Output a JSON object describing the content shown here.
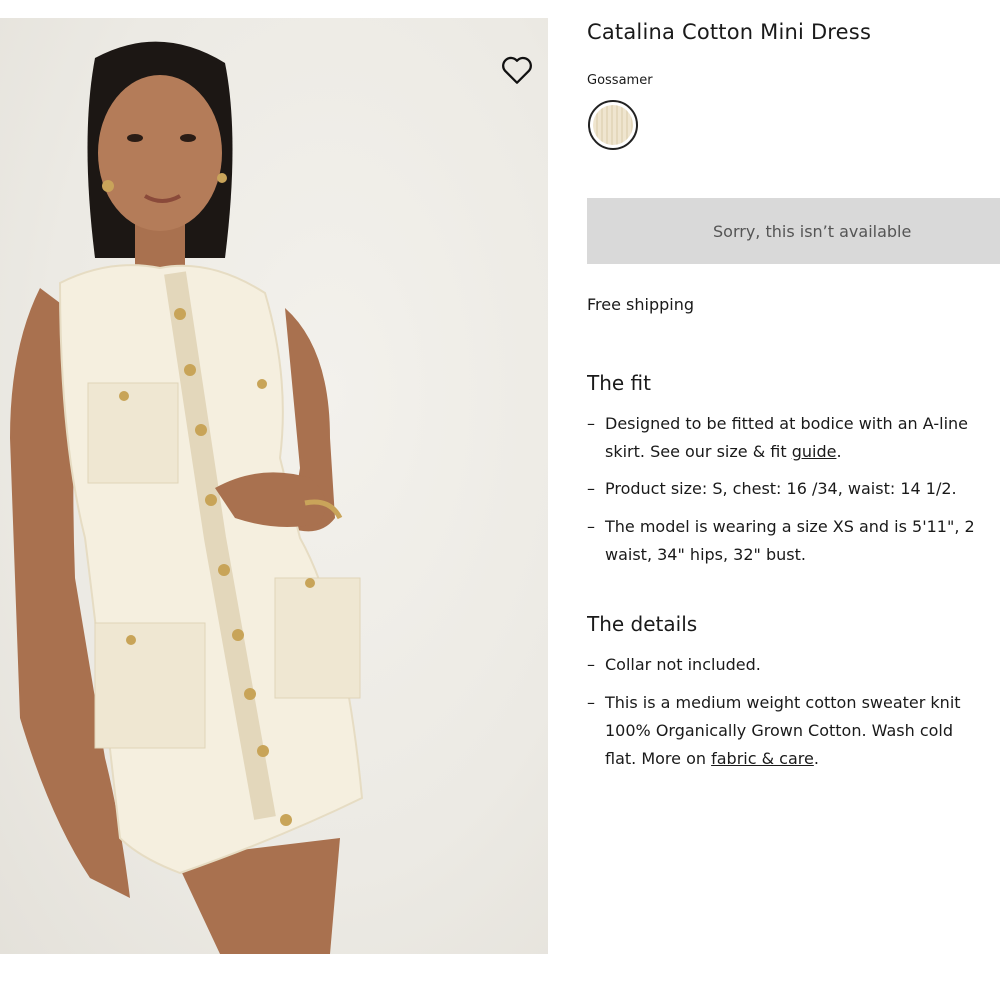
{
  "product": {
    "title": "Catalina Cotton Mini Dress",
    "color_name": "Gossamer",
    "unavailable_label": "Sorry, this isn’t available",
    "shipping": "Free shipping"
  },
  "fit": {
    "heading": "The fit",
    "b1_line1": "Designed to be fitted at bodice with an A-line",
    "b1_line2_pre": "skirt. See our size & fit ",
    "b1_link": "guide",
    "b1_line2_post": ".",
    "b2": "Product size: S, chest: 16 /34, waist: 14 1/2.",
    "b3_line1": "The model is wearing a size XS and is 5'11\", 2",
    "b3_line2": "waist, 34\" hips, 32\" bust."
  },
  "details": {
    "heading": "The details",
    "b1": "Collar not included.",
    "b2_line1": "This is a medium weight cotton sweater knit",
    "b2_line2": "100% Organically Grown Cotton. Wash cold",
    "b2_line3_pre": "flat. More on ",
    "b2_link": "fabric & care",
    "b2_line3_post": "."
  },
  "dash": "–",
  "icons": {
    "wishlist": "heart-outline-icon",
    "swatch": "color-swatch"
  },
  "colors": {
    "unavailable_bg": "#d9d9d9",
    "swatch": "#efe5cf",
    "dress": "#f5efdf"
  }
}
